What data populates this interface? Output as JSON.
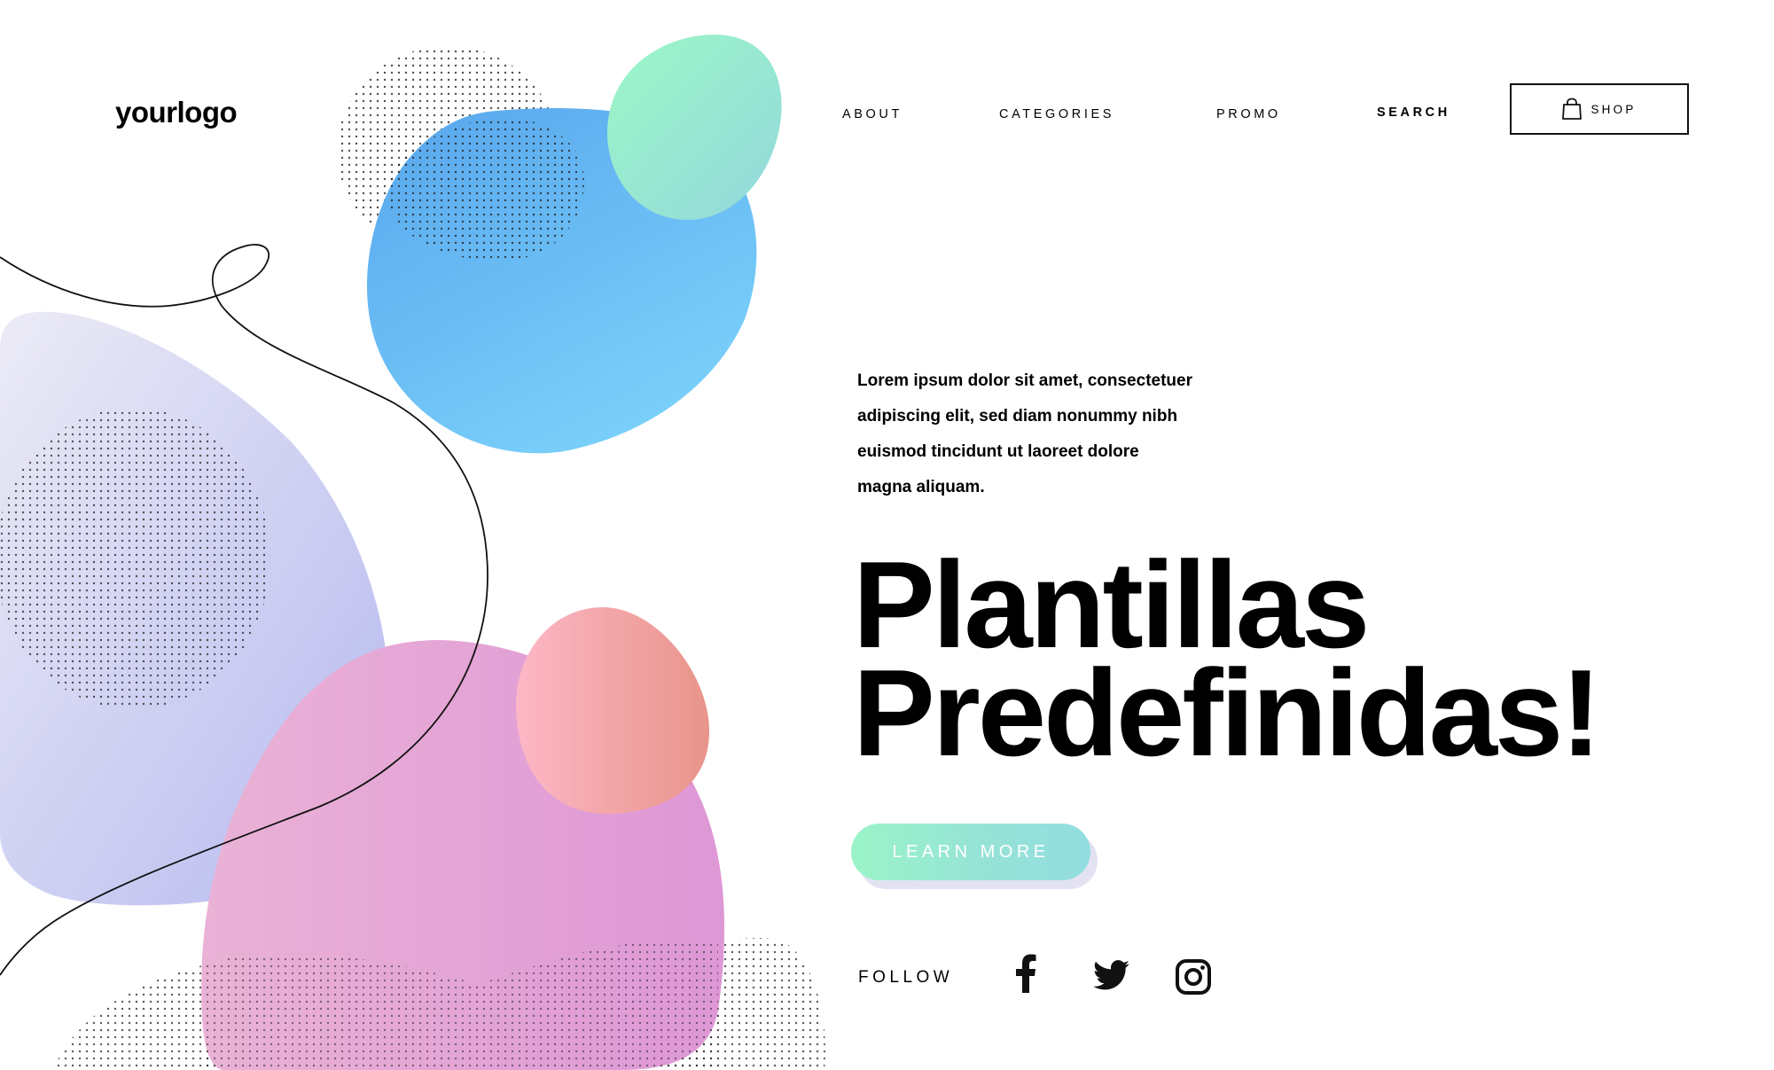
{
  "header": {
    "logo": "yourlogo",
    "nav": {
      "about": "ABOUT",
      "categories": "CATEGORIES",
      "promo": "PROMO",
      "search": "SEARCH"
    },
    "shop": {
      "label": "SHOP",
      "icon": "shopping-bag-icon"
    }
  },
  "hero": {
    "intro_lines": [
      "Lorem ipsum dolor sit amet, consectetuer",
      "adipiscing elit, sed diam nonummy nibh",
      "euismod tincidunt ut laoreet dolore",
      "magna aliquam."
    ],
    "headline_lines": [
      "Plantillas",
      "Predefinidas!"
    ],
    "cta_label": "LEARN MORE"
  },
  "follow": {
    "label": "FOLLOW",
    "social_icons": [
      "facebook-icon",
      "twitter-icon",
      "instagram-icon"
    ]
  },
  "colors": {
    "text": "#000000",
    "blue_blob": "#6cc3f5",
    "mint_blob": "#9af4c8",
    "lavender_blob": "#c4c6f0",
    "pink_blob": "#e0a0d8",
    "peach_blob": "#f4a8a8",
    "cta_gradient_start": "#9af4c8",
    "cta_gradient_end": "#93dde0"
  }
}
